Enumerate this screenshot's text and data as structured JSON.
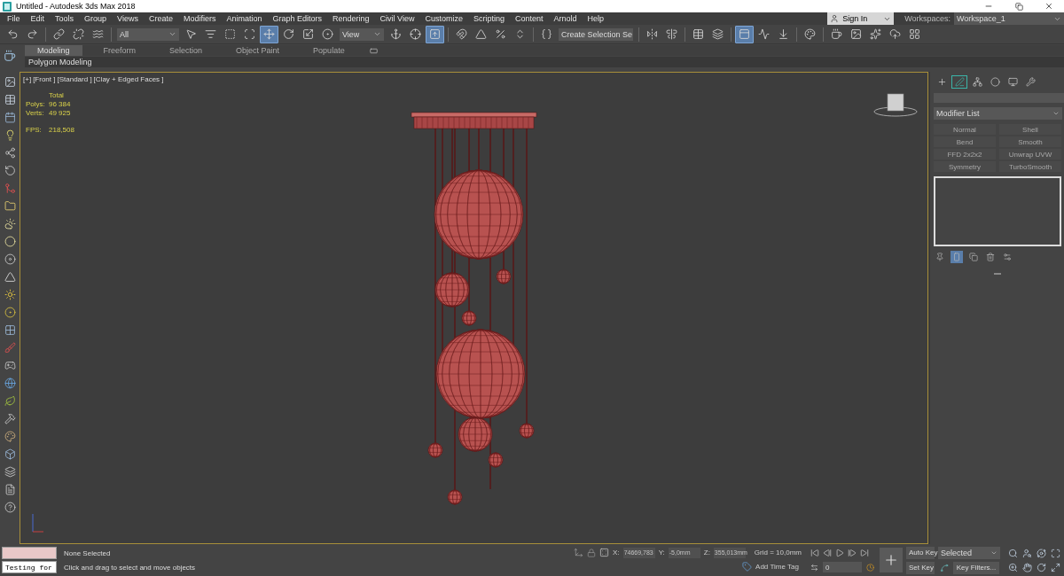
{
  "window": {
    "title": "Untitled - Autodesk 3ds Max 2018"
  },
  "menu": [
    "File",
    "Edit",
    "Tools",
    "Group",
    "Views",
    "Create",
    "Modifiers",
    "Animation",
    "Graph Editors",
    "Rendering",
    "Civil View",
    "Customize",
    "Scripting",
    "Content",
    "Arnold",
    "Help"
  ],
  "account": {
    "sign_in": "Sign In",
    "workspaces_label": "Workspaces:",
    "workspace": "Workspace_1"
  },
  "main_toolbar": {
    "selection_filter": "All",
    "reference_coordinate": "View",
    "named_selection": "Create Selection Se",
    "buttons": [
      {
        "selected": false
      },
      {
        "selected": false
      },
      {
        "selected": false
      },
      {
        "selected": false
      },
      {
        "selected": false
      },
      {
        "selected": false
      },
      {
        "selected": false
      },
      {
        "selected": false
      },
      {
        "selected": false
      },
      {
        "selected": true
      },
      {
        "selected": false
      },
      {
        "selected": false
      },
      {
        "selected": false
      },
      {
        "selected": false
      },
      {
        "selected": false
      },
      {
        "selected": true
      },
      {
        "selected": false
      },
      {
        "selected": false
      },
      {
        "selected": false
      },
      {
        "selected": false
      },
      {
        "selected": false
      },
      {
        "selected": false
      },
      {
        "selected": false
      },
      {
        "selected": false
      },
      {
        "selected": false
      },
      {
        "selected": true
      },
      {
        "selected": false
      },
      {
        "selected": false
      },
      {
        "selected": false
      },
      {
        "selected": false
      },
      {
        "selected": false
      },
      {
        "selected": false
      },
      {
        "selected": false
      },
      {
        "selected": false
      }
    ]
  },
  "ribbon": {
    "tabs": [
      {
        "label": "Modeling",
        "selected": true
      },
      {
        "label": "Freeform",
        "selected": false
      },
      {
        "label": "Selection",
        "selected": false
      },
      {
        "label": "Object Paint",
        "selected": false
      },
      {
        "label": "Populate",
        "selected": false
      }
    ],
    "panel": "Polygon Modeling"
  },
  "viewport": {
    "labels": [
      "[+]",
      "[Front ]",
      "[Standard ]",
      "[Clay + Edged Faces ]"
    ],
    "stats": {
      "heading": "Total",
      "rows": [
        {
          "label": "Polys:",
          "value": "96 384"
        },
        {
          "label": "Verts:",
          "value": "49 925"
        }
      ],
      "fps_label": "FPS:",
      "fps": "218,508"
    }
  },
  "command_panel": {
    "tabs": [
      {
        "selected": false
      },
      {
        "selected": true
      },
      {
        "selected": false
      },
      {
        "selected": false
      },
      {
        "selected": false
      },
      {
        "selected": false
      }
    ],
    "modifier_list": "Modifier List",
    "modifier_buttons": [
      {
        "label": "Normal",
        "disabled": true
      },
      {
        "label": "Shell",
        "disabled": true
      },
      {
        "label": "Bend",
        "disabled": true
      },
      {
        "label": "Smooth",
        "disabled": true
      },
      {
        "label": "FFD 2x2x2",
        "disabled": true
      },
      {
        "label": "Unwrap UVW",
        "disabled": true
      },
      {
        "label": "Symmetry",
        "disabled": true
      },
      {
        "label": "TurboSmooth",
        "disabled": true
      }
    ],
    "stack_tools": [
      {
        "selected": false
      },
      {
        "selected": true
      },
      {
        "selected": false
      },
      {
        "selected": false
      },
      {
        "selected": false
      }
    ]
  },
  "status_bar": {
    "listener": "Testing for",
    "selection": "None Selected",
    "prompt": "Click and drag to select and move objects",
    "coords": [
      {
        "axis": "X:",
        "value": "74669,783"
      },
      {
        "axis": "Y:",
        "value": "-5,0mm"
      },
      {
        "axis": "Z:",
        "value": "355,013mm"
      }
    ],
    "grid": "Grid = 10,0mm",
    "time_tag": "Add Time Tag",
    "frame": "0",
    "auto_key": "Auto Key",
    "key_set": "Selected",
    "set_key": "Set Key",
    "key_filters": "Key Filters..."
  }
}
